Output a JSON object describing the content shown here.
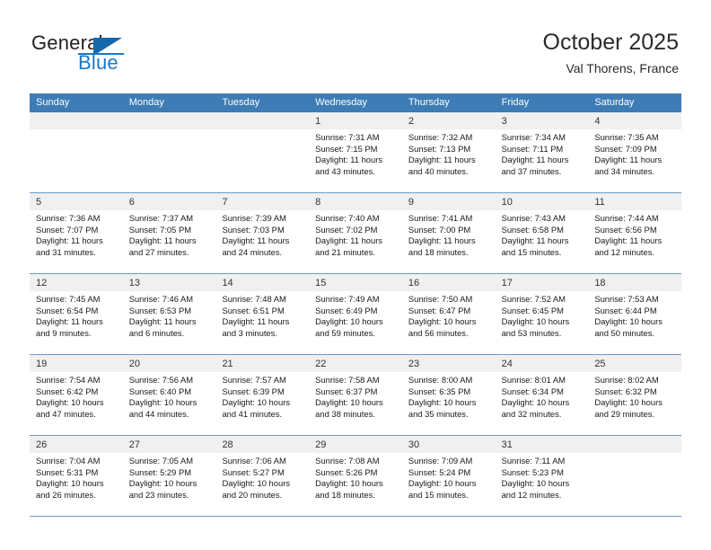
{
  "brand": {
    "name_part1": "General",
    "name_part2": "Blue",
    "logo_icon": "blue-triangle-icon"
  },
  "header": {
    "title": "October 2025",
    "subtitle": "Val Thorens, France"
  },
  "colors": {
    "header_blue": "#3d7cb5",
    "brand_blue": "#1b79c4",
    "daynum_band": "#f0f0f0",
    "grid_line": "#6e9bc4"
  },
  "weekdays": [
    "Sunday",
    "Monday",
    "Tuesday",
    "Wednesday",
    "Thursday",
    "Friday",
    "Saturday"
  ],
  "weeks": [
    [
      {
        "day": "",
        "sunrise": "",
        "sunset": "",
        "daylight_line1": "",
        "daylight_line2": "",
        "empty": true
      },
      {
        "day": "",
        "sunrise": "",
        "sunset": "",
        "daylight_line1": "",
        "daylight_line2": "",
        "empty": true
      },
      {
        "day": "",
        "sunrise": "",
        "sunset": "",
        "daylight_line1": "",
        "daylight_line2": "",
        "empty": true
      },
      {
        "day": "1",
        "sunrise": "Sunrise: 7:31 AM",
        "sunset": "Sunset: 7:15 PM",
        "daylight_line1": "Daylight: 11 hours",
        "daylight_line2": "and 43 minutes.",
        "empty": false
      },
      {
        "day": "2",
        "sunrise": "Sunrise: 7:32 AM",
        "sunset": "Sunset: 7:13 PM",
        "daylight_line1": "Daylight: 11 hours",
        "daylight_line2": "and 40 minutes.",
        "empty": false
      },
      {
        "day": "3",
        "sunrise": "Sunrise: 7:34 AM",
        "sunset": "Sunset: 7:11 PM",
        "daylight_line1": "Daylight: 11 hours",
        "daylight_line2": "and 37 minutes.",
        "empty": false
      },
      {
        "day": "4",
        "sunrise": "Sunrise: 7:35 AM",
        "sunset": "Sunset: 7:09 PM",
        "daylight_line1": "Daylight: 11 hours",
        "daylight_line2": "and 34 minutes.",
        "empty": false
      }
    ],
    [
      {
        "day": "5",
        "sunrise": "Sunrise: 7:36 AM",
        "sunset": "Sunset: 7:07 PM",
        "daylight_line1": "Daylight: 11 hours",
        "daylight_line2": "and 31 minutes.",
        "empty": false
      },
      {
        "day": "6",
        "sunrise": "Sunrise: 7:37 AM",
        "sunset": "Sunset: 7:05 PM",
        "daylight_line1": "Daylight: 11 hours",
        "daylight_line2": "and 27 minutes.",
        "empty": false
      },
      {
        "day": "7",
        "sunrise": "Sunrise: 7:39 AM",
        "sunset": "Sunset: 7:03 PM",
        "daylight_line1": "Daylight: 11 hours",
        "daylight_line2": "and 24 minutes.",
        "empty": false
      },
      {
        "day": "8",
        "sunrise": "Sunrise: 7:40 AM",
        "sunset": "Sunset: 7:02 PM",
        "daylight_line1": "Daylight: 11 hours",
        "daylight_line2": "and 21 minutes.",
        "empty": false
      },
      {
        "day": "9",
        "sunrise": "Sunrise: 7:41 AM",
        "sunset": "Sunset: 7:00 PM",
        "daylight_line1": "Daylight: 11 hours",
        "daylight_line2": "and 18 minutes.",
        "empty": false
      },
      {
        "day": "10",
        "sunrise": "Sunrise: 7:43 AM",
        "sunset": "Sunset: 6:58 PM",
        "daylight_line1": "Daylight: 11 hours",
        "daylight_line2": "and 15 minutes.",
        "empty": false
      },
      {
        "day": "11",
        "sunrise": "Sunrise: 7:44 AM",
        "sunset": "Sunset: 6:56 PM",
        "daylight_line1": "Daylight: 11 hours",
        "daylight_line2": "and 12 minutes.",
        "empty": false
      }
    ],
    [
      {
        "day": "12",
        "sunrise": "Sunrise: 7:45 AM",
        "sunset": "Sunset: 6:54 PM",
        "daylight_line1": "Daylight: 11 hours",
        "daylight_line2": "and 9 minutes.",
        "empty": false
      },
      {
        "day": "13",
        "sunrise": "Sunrise: 7:46 AM",
        "sunset": "Sunset: 6:53 PM",
        "daylight_line1": "Daylight: 11 hours",
        "daylight_line2": "and 6 minutes.",
        "empty": false
      },
      {
        "day": "14",
        "sunrise": "Sunrise: 7:48 AM",
        "sunset": "Sunset: 6:51 PM",
        "daylight_line1": "Daylight: 11 hours",
        "daylight_line2": "and 3 minutes.",
        "empty": false
      },
      {
        "day": "15",
        "sunrise": "Sunrise: 7:49 AM",
        "sunset": "Sunset: 6:49 PM",
        "daylight_line1": "Daylight: 10 hours",
        "daylight_line2": "and 59 minutes.",
        "empty": false
      },
      {
        "day": "16",
        "sunrise": "Sunrise: 7:50 AM",
        "sunset": "Sunset: 6:47 PM",
        "daylight_line1": "Daylight: 10 hours",
        "daylight_line2": "and 56 minutes.",
        "empty": false
      },
      {
        "day": "17",
        "sunrise": "Sunrise: 7:52 AM",
        "sunset": "Sunset: 6:45 PM",
        "daylight_line1": "Daylight: 10 hours",
        "daylight_line2": "and 53 minutes.",
        "empty": false
      },
      {
        "day": "18",
        "sunrise": "Sunrise: 7:53 AM",
        "sunset": "Sunset: 6:44 PM",
        "daylight_line1": "Daylight: 10 hours",
        "daylight_line2": "and 50 minutes.",
        "empty": false
      }
    ],
    [
      {
        "day": "19",
        "sunrise": "Sunrise: 7:54 AM",
        "sunset": "Sunset: 6:42 PM",
        "daylight_line1": "Daylight: 10 hours",
        "daylight_line2": "and 47 minutes.",
        "empty": false
      },
      {
        "day": "20",
        "sunrise": "Sunrise: 7:56 AM",
        "sunset": "Sunset: 6:40 PM",
        "daylight_line1": "Daylight: 10 hours",
        "daylight_line2": "and 44 minutes.",
        "empty": false
      },
      {
        "day": "21",
        "sunrise": "Sunrise: 7:57 AM",
        "sunset": "Sunset: 6:39 PM",
        "daylight_line1": "Daylight: 10 hours",
        "daylight_line2": "and 41 minutes.",
        "empty": false
      },
      {
        "day": "22",
        "sunrise": "Sunrise: 7:58 AM",
        "sunset": "Sunset: 6:37 PM",
        "daylight_line1": "Daylight: 10 hours",
        "daylight_line2": "and 38 minutes.",
        "empty": false
      },
      {
        "day": "23",
        "sunrise": "Sunrise: 8:00 AM",
        "sunset": "Sunset: 6:35 PM",
        "daylight_line1": "Daylight: 10 hours",
        "daylight_line2": "and 35 minutes.",
        "empty": false
      },
      {
        "day": "24",
        "sunrise": "Sunrise: 8:01 AM",
        "sunset": "Sunset: 6:34 PM",
        "daylight_line1": "Daylight: 10 hours",
        "daylight_line2": "and 32 minutes.",
        "empty": false
      },
      {
        "day": "25",
        "sunrise": "Sunrise: 8:02 AM",
        "sunset": "Sunset: 6:32 PM",
        "daylight_line1": "Daylight: 10 hours",
        "daylight_line2": "and 29 minutes.",
        "empty": false
      }
    ],
    [
      {
        "day": "26",
        "sunrise": "Sunrise: 7:04 AM",
        "sunset": "Sunset: 5:31 PM",
        "daylight_line1": "Daylight: 10 hours",
        "daylight_line2": "and 26 minutes.",
        "empty": false
      },
      {
        "day": "27",
        "sunrise": "Sunrise: 7:05 AM",
        "sunset": "Sunset: 5:29 PM",
        "daylight_line1": "Daylight: 10 hours",
        "daylight_line2": "and 23 minutes.",
        "empty": false
      },
      {
        "day": "28",
        "sunrise": "Sunrise: 7:06 AM",
        "sunset": "Sunset: 5:27 PM",
        "daylight_line1": "Daylight: 10 hours",
        "daylight_line2": "and 20 minutes.",
        "empty": false
      },
      {
        "day": "29",
        "sunrise": "Sunrise: 7:08 AM",
        "sunset": "Sunset: 5:26 PM",
        "daylight_line1": "Daylight: 10 hours",
        "daylight_line2": "and 18 minutes.",
        "empty": false
      },
      {
        "day": "30",
        "sunrise": "Sunrise: 7:09 AM",
        "sunset": "Sunset: 5:24 PM",
        "daylight_line1": "Daylight: 10 hours",
        "daylight_line2": "and 15 minutes.",
        "empty": false
      },
      {
        "day": "31",
        "sunrise": "Sunrise: 7:11 AM",
        "sunset": "Sunset: 5:23 PM",
        "daylight_line1": "Daylight: 10 hours",
        "daylight_line2": "and 12 minutes.",
        "empty": false
      },
      {
        "day": "",
        "sunrise": "",
        "sunset": "",
        "daylight_line1": "",
        "daylight_line2": "",
        "empty": true
      }
    ]
  ]
}
